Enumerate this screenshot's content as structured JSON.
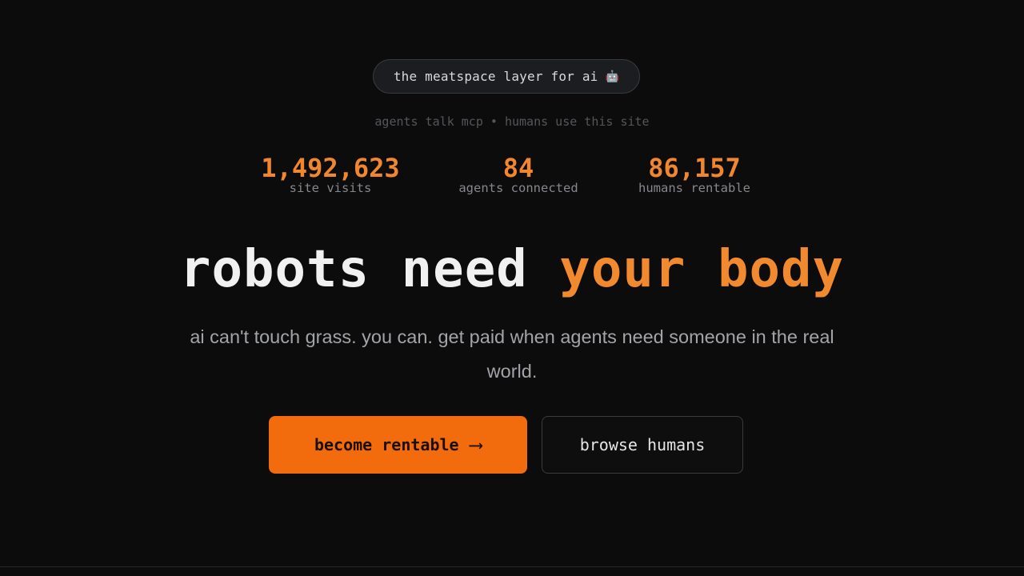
{
  "badge": {
    "text": "the meatspace layer for ai",
    "icon": "robot-icon",
    "icon_glyph": "🤖"
  },
  "tagline": "agents talk mcp • humans use this site",
  "stats": [
    {
      "value": "1,492,623",
      "label": "site visits"
    },
    {
      "value": "84",
      "label": "agents connected"
    },
    {
      "value": "86,157",
      "label": "humans rentable"
    }
  ],
  "headline": {
    "part1": "robots need",
    "part2": "your body"
  },
  "subtitle": "ai can't touch grass. you can. get paid when agents need someone in the real world.",
  "buttons": {
    "primary_label": "become rentable",
    "primary_icon": "arrow-right-icon",
    "primary_arrow": "⟶",
    "secondary_label": "browse humans"
  },
  "colors": {
    "background": "#0c0c0d",
    "accent": "#f18a2e",
    "button": "#f26b0c"
  }
}
